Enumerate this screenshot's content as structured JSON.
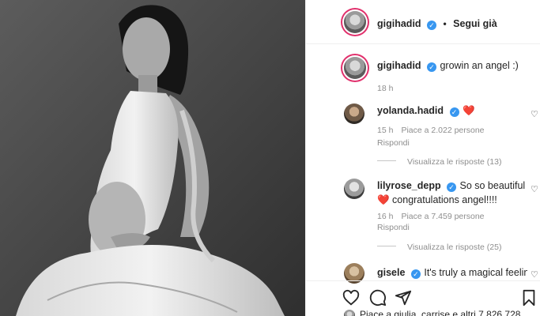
{
  "post": {
    "author": "gigihadid",
    "follow_label": "Segui già",
    "caption": "growin an angel :)",
    "time": "18 h"
  },
  "comments": [
    {
      "user": "yolanda.hadid",
      "text": "❤️",
      "time": "15 h",
      "likes": "Piace a 2.022 persone",
      "reply": "Rispondi",
      "view_replies": "Visualizza le risposte (13)"
    },
    {
      "user": "lilyrose_depp",
      "text": "So so beautiful ❤️ congratulations angel!!!!",
      "time": "16 h",
      "likes": "Piace a 7.459 persone",
      "reply": "Rispondi",
      "view_replies": "Visualizza le risposte (25)"
    },
    {
      "user": "gisele",
      "text": "It's truly a magical feeling"
    }
  ],
  "likes_line": "Piace a giulia_carrise e altri 7.826.728",
  "icons": [
    "heart-icon",
    "comment-icon",
    "share-icon",
    "bookmark-icon",
    "verified-badge-icon"
  ],
  "colors": {
    "verified": "#3897f0",
    "like_red": "#ed4956",
    "text": "#262626",
    "muted": "#8e8e8e"
  }
}
